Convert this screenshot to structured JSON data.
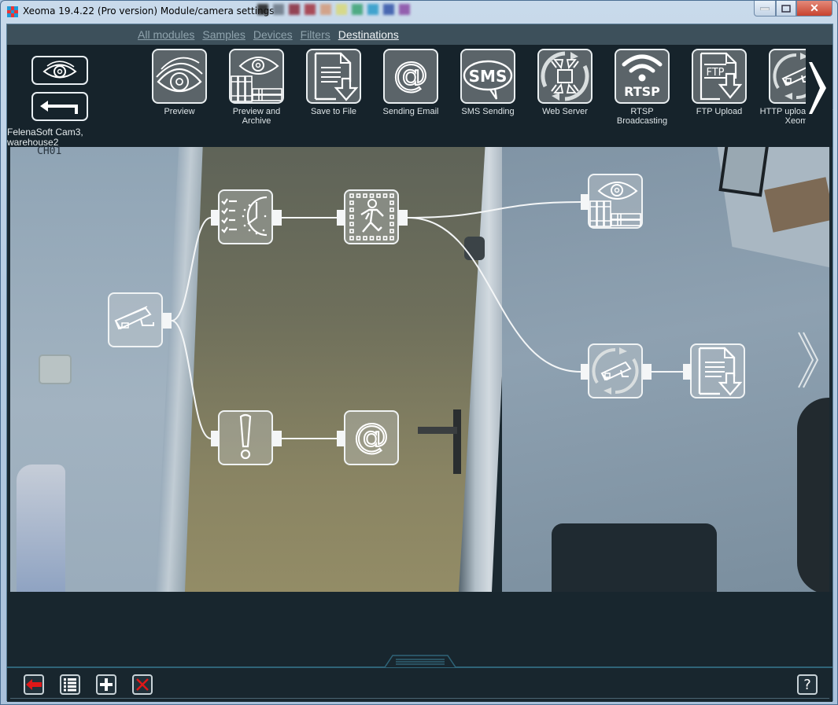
{
  "window": {
    "title": "Xeoma 19.4.22 (Pro version) Module/camera settings",
    "controls": {
      "minimize": "minimize",
      "maximize": "maximize",
      "close": "close"
    },
    "swatch_colors": [
      "#1b1b1b",
      "#6b7784",
      "#8a2a3a",
      "#a3333f",
      "#d49a7a",
      "#d9d97a",
      "#3aa373",
      "#2a9ac9",
      "#3354a8",
      "#8a4aa5"
    ]
  },
  "nav": {
    "tabs": [
      {
        "label": "All modules",
        "active": false
      },
      {
        "label": "Samples",
        "active": false
      },
      {
        "label": "Devices",
        "active": false
      },
      {
        "label": "Filters",
        "active": false
      },
      {
        "label": "Destinations",
        "active": true
      }
    ]
  },
  "left_controls": {
    "preview_button": "eye-icon",
    "back_button": "return-arrow-icon",
    "camera_name": "FelenaSoft Cam3,",
    "camera_location": "warehouse2"
  },
  "modules": [
    {
      "label": "Preview",
      "icon": "eye-icon"
    },
    {
      "label": "Preview and Archive",
      "icon": "eye-archive-icon"
    },
    {
      "label": "Save to File",
      "icon": "save-file-icon"
    },
    {
      "label": "Sending Email",
      "icon": "at-icon"
    },
    {
      "label": "SMS Sending",
      "icon": "sms-icon"
    },
    {
      "label": "Web Server",
      "icon": "web-server-icon"
    },
    {
      "label": "RTSP Broadcasting",
      "icon": "rtsp-icon",
      "icon_text": "RTSP"
    },
    {
      "label": "FTP Upload",
      "icon": "ftp-icon",
      "icon_text": "FTP"
    },
    {
      "label": "HTTP upload to other Xeoma",
      "label_visible": "HTTP upload other Xeom",
      "icon": "http-upload-icon"
    }
  ],
  "preview": {
    "channel_overlay": "CH01",
    "graph_nodes": [
      {
        "id": "camera",
        "icon": "camera-icon"
      },
      {
        "id": "scheduler",
        "icon": "scheduler-icon"
      },
      {
        "id": "motion-detector",
        "icon": "motion-detector-icon"
      },
      {
        "id": "preview-archive",
        "icon": "eye-archive-icon"
      },
      {
        "id": "problems-detector",
        "icon": "exclamation-icon"
      },
      {
        "id": "sending-email",
        "icon": "at-icon",
        "icon_text": "@"
      },
      {
        "id": "http-upload",
        "icon": "http-upload-icon"
      },
      {
        "id": "save-to-file",
        "icon": "save-file-icon"
      }
    ],
    "connections": [
      [
        "camera",
        "scheduler"
      ],
      [
        "camera",
        "problems-detector"
      ],
      [
        "scheduler",
        "motion-detector"
      ],
      [
        "motion-detector",
        "preview-archive"
      ],
      [
        "motion-detector",
        "http-upload"
      ],
      [
        "problems-detector",
        "sending-email"
      ],
      [
        "http-upload",
        "save-to-file"
      ]
    ]
  },
  "toolbar": {
    "back": "back-arrow-icon",
    "list": "list-icon",
    "add": "plus-icon",
    "delete": "delete-x-icon",
    "help_label": "?",
    "accent_red": "#e01818"
  },
  "at_symbol": "@",
  "sms_text": "SMS"
}
